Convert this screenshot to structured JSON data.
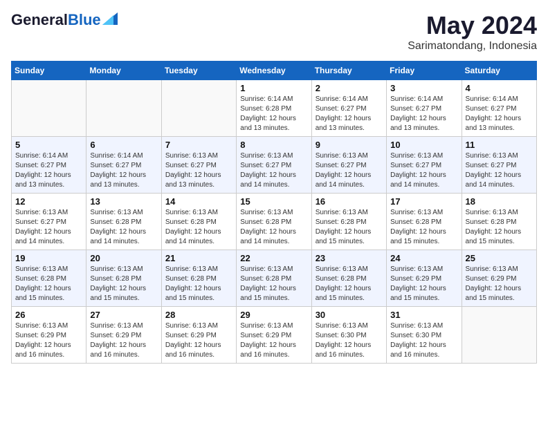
{
  "logo": {
    "part1": "General",
    "part2": "Blue"
  },
  "title": {
    "month_year": "May 2024",
    "location": "Sarimatondang, Indonesia"
  },
  "weekdays": [
    "Sunday",
    "Monday",
    "Tuesday",
    "Wednesday",
    "Thursday",
    "Friday",
    "Saturday"
  ],
  "weeks": [
    [
      {
        "day": "",
        "info": ""
      },
      {
        "day": "",
        "info": ""
      },
      {
        "day": "",
        "info": ""
      },
      {
        "day": "1",
        "info": "Sunrise: 6:14 AM\nSunset: 6:28 PM\nDaylight: 12 hours\nand 13 minutes."
      },
      {
        "day": "2",
        "info": "Sunrise: 6:14 AM\nSunset: 6:27 PM\nDaylight: 12 hours\nand 13 minutes."
      },
      {
        "day": "3",
        "info": "Sunrise: 6:14 AM\nSunset: 6:27 PM\nDaylight: 12 hours\nand 13 minutes."
      },
      {
        "day": "4",
        "info": "Sunrise: 6:14 AM\nSunset: 6:27 PM\nDaylight: 12 hours\nand 13 minutes."
      }
    ],
    [
      {
        "day": "5",
        "info": "Sunrise: 6:14 AM\nSunset: 6:27 PM\nDaylight: 12 hours\nand 13 minutes."
      },
      {
        "day": "6",
        "info": "Sunrise: 6:14 AM\nSunset: 6:27 PM\nDaylight: 12 hours\nand 13 minutes."
      },
      {
        "day": "7",
        "info": "Sunrise: 6:13 AM\nSunset: 6:27 PM\nDaylight: 12 hours\nand 13 minutes."
      },
      {
        "day": "8",
        "info": "Sunrise: 6:13 AM\nSunset: 6:27 PM\nDaylight: 12 hours\nand 14 minutes."
      },
      {
        "day": "9",
        "info": "Sunrise: 6:13 AM\nSunset: 6:27 PM\nDaylight: 12 hours\nand 14 minutes."
      },
      {
        "day": "10",
        "info": "Sunrise: 6:13 AM\nSunset: 6:27 PM\nDaylight: 12 hours\nand 14 minutes."
      },
      {
        "day": "11",
        "info": "Sunrise: 6:13 AM\nSunset: 6:27 PM\nDaylight: 12 hours\nand 14 minutes."
      }
    ],
    [
      {
        "day": "12",
        "info": "Sunrise: 6:13 AM\nSunset: 6:27 PM\nDaylight: 12 hours\nand 14 minutes."
      },
      {
        "day": "13",
        "info": "Sunrise: 6:13 AM\nSunset: 6:28 PM\nDaylight: 12 hours\nand 14 minutes."
      },
      {
        "day": "14",
        "info": "Sunrise: 6:13 AM\nSunset: 6:28 PM\nDaylight: 12 hours\nand 14 minutes."
      },
      {
        "day": "15",
        "info": "Sunrise: 6:13 AM\nSunset: 6:28 PM\nDaylight: 12 hours\nand 14 minutes."
      },
      {
        "day": "16",
        "info": "Sunrise: 6:13 AM\nSunset: 6:28 PM\nDaylight: 12 hours\nand 15 minutes."
      },
      {
        "day": "17",
        "info": "Sunrise: 6:13 AM\nSunset: 6:28 PM\nDaylight: 12 hours\nand 15 minutes."
      },
      {
        "day": "18",
        "info": "Sunrise: 6:13 AM\nSunset: 6:28 PM\nDaylight: 12 hours\nand 15 minutes."
      }
    ],
    [
      {
        "day": "19",
        "info": "Sunrise: 6:13 AM\nSunset: 6:28 PM\nDaylight: 12 hours\nand 15 minutes."
      },
      {
        "day": "20",
        "info": "Sunrise: 6:13 AM\nSunset: 6:28 PM\nDaylight: 12 hours\nand 15 minutes."
      },
      {
        "day": "21",
        "info": "Sunrise: 6:13 AM\nSunset: 6:28 PM\nDaylight: 12 hours\nand 15 minutes."
      },
      {
        "day": "22",
        "info": "Sunrise: 6:13 AM\nSunset: 6:28 PM\nDaylight: 12 hours\nand 15 minutes."
      },
      {
        "day": "23",
        "info": "Sunrise: 6:13 AM\nSunset: 6:28 PM\nDaylight: 12 hours\nand 15 minutes."
      },
      {
        "day": "24",
        "info": "Sunrise: 6:13 AM\nSunset: 6:29 PM\nDaylight: 12 hours\nand 15 minutes."
      },
      {
        "day": "25",
        "info": "Sunrise: 6:13 AM\nSunset: 6:29 PM\nDaylight: 12 hours\nand 15 minutes."
      }
    ],
    [
      {
        "day": "26",
        "info": "Sunrise: 6:13 AM\nSunset: 6:29 PM\nDaylight: 12 hours\nand 16 minutes."
      },
      {
        "day": "27",
        "info": "Sunrise: 6:13 AM\nSunset: 6:29 PM\nDaylight: 12 hours\nand 16 minutes."
      },
      {
        "day": "28",
        "info": "Sunrise: 6:13 AM\nSunset: 6:29 PM\nDaylight: 12 hours\nand 16 minutes."
      },
      {
        "day": "29",
        "info": "Sunrise: 6:13 AM\nSunset: 6:29 PM\nDaylight: 12 hours\nand 16 minutes."
      },
      {
        "day": "30",
        "info": "Sunrise: 6:13 AM\nSunset: 6:30 PM\nDaylight: 12 hours\nand 16 minutes."
      },
      {
        "day": "31",
        "info": "Sunrise: 6:13 AM\nSunset: 6:30 PM\nDaylight: 12 hours\nand 16 minutes."
      },
      {
        "day": "",
        "info": ""
      }
    ]
  ]
}
